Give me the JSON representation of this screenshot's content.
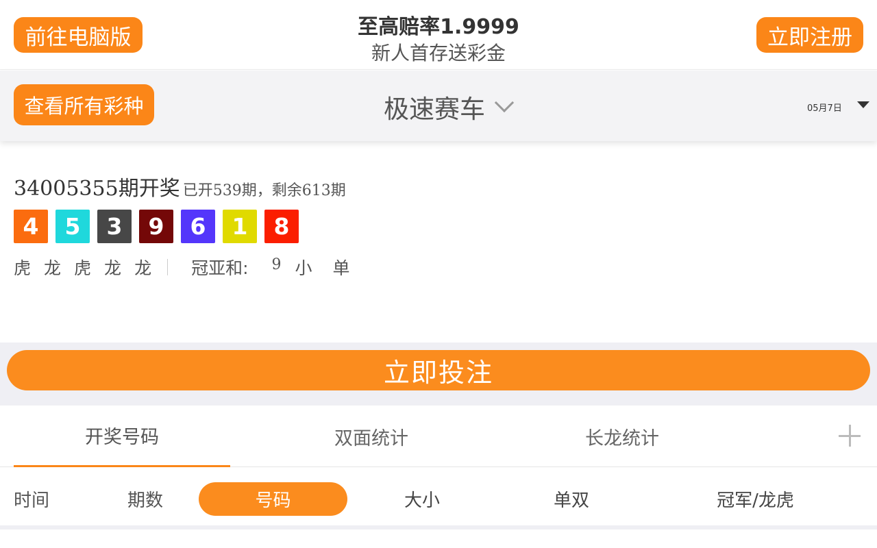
{
  "header": {
    "pc_button": "前往电脑版",
    "promo_title": "至高赔率1.9999",
    "promo_subtitle": "新人首存送彩金",
    "register_button": "立即注册"
  },
  "subheader": {
    "all_lotteries_button": "查看所有彩种",
    "game_title": "极速赛车",
    "date": "05月7日"
  },
  "draw": {
    "issue": "34005355",
    "issue_suffix": "期开奖",
    "meta_prefix": "已开",
    "opened": "539",
    "meta_mid": "期，剩余",
    "remaining": "613",
    "meta_suffix": "期",
    "balls": [
      {
        "number": "4",
        "color": "#fb6c0f"
      },
      {
        "number": "5",
        "color": "#1fd8dc"
      },
      {
        "number": "3",
        "color": "#474747"
      },
      {
        "number": "9",
        "color": "#740808"
      },
      {
        "number": "6",
        "color": "#5436fb"
      },
      {
        "number": "1",
        "color": "#e0da00"
      },
      {
        "number": "8",
        "color": "#fb1e00"
      }
    ],
    "dragon_tiger": [
      "虎",
      "龙",
      "虎",
      "龙",
      "龙"
    ],
    "sum_label": "冠亚和:",
    "sum_value": "9",
    "sum_size": "小",
    "sum_parity": "单"
  },
  "bet_button": "立即投注",
  "tabs": [
    "开奖号码",
    "双面统计",
    "长龙统计"
  ],
  "filters": [
    "时间",
    "期数",
    "号码",
    "大小",
    "单双",
    "冠军/龙虎"
  ],
  "colors": {
    "accent": "#fb8618"
  },
  "icons": {
    "dropdown": "chevron-down-icon",
    "date_dropdown": "caret-down-icon",
    "more_tabs": "plus-icon"
  }
}
